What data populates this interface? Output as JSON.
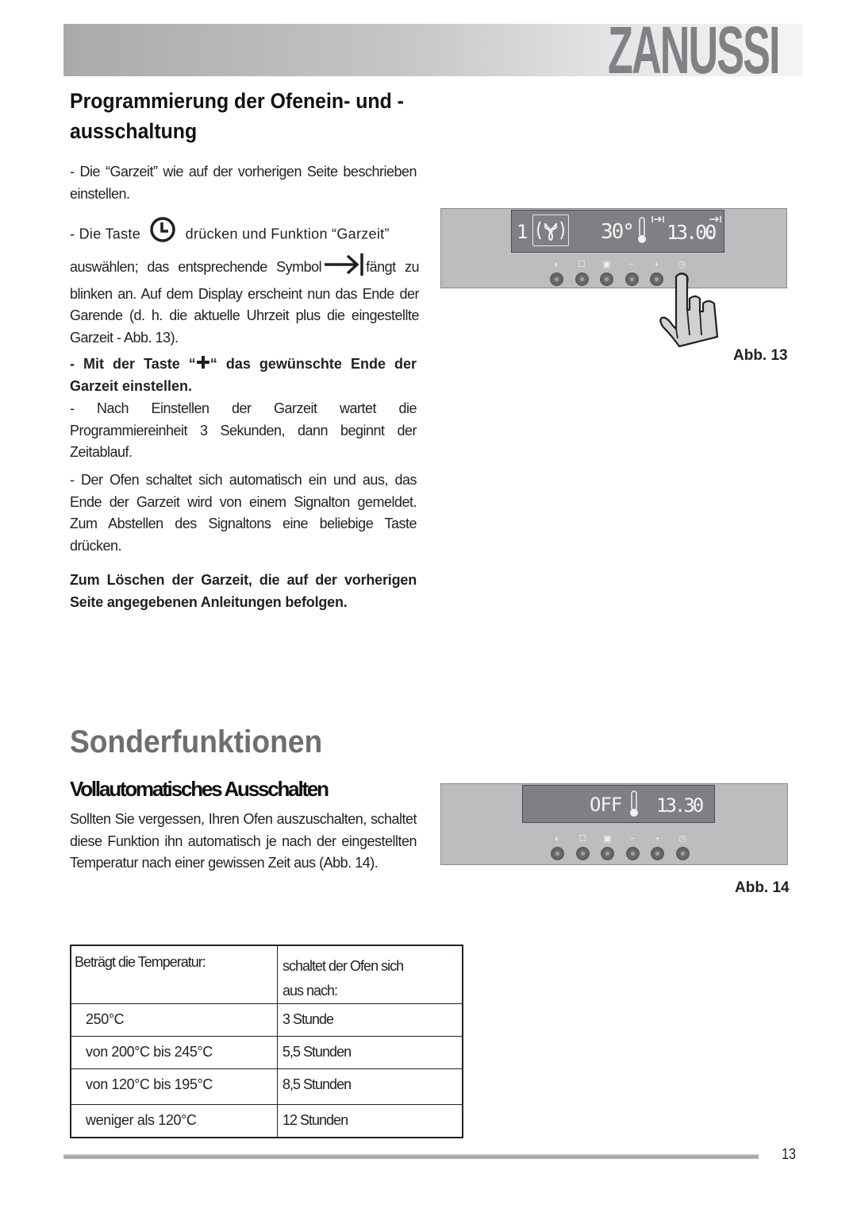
{
  "header": {
    "brand": "ZANUSSI"
  },
  "section1": {
    "title": "Programmierung der Ofenein- und - ausschaltung",
    "p1": "- Die “Garzeit” wie auf der vorherigen Seite beschrieben einstellen.",
    "p2_a": "- Die Taste",
    "p2_icon": "clock-icon",
    "p2_b": "drücken und Funktion “Garzeit”",
    "p2_c": "auswählen; das entsprechende Symbol",
    "p2_symbol": "arrow-to-bar-icon",
    "p2_d": "fängt zu blinken an. Auf dem Display erscheint nun das Ende der Garende (d. h. die aktuelle Uhrzeit plus die eingestellte Garzeit - Abb. 13).",
    "p3_a": "- Mit der Taste “",
    "p3_icon": "plus-icon",
    "p3_b": "“ das gewünschte Ende der Garzeit einstellen.",
    "p4": "- Nach Einstellen der Garzeit wartet die Programmiereinheit 3 Sekunden, dann beginnt der Zeitablauf.",
    "p5": "- Der Ofen schaltet sich automatisch ein und aus, das Ende der Garzeit wird von einem Signalton gemeldet. Zum Abstellen des Signaltons eine beliebige Taste drücken.",
    "p6": "Zum Löschen der Garzeit, die auf der vorherigen Seite angegebenen Anleitungen befolgen."
  },
  "figure13": {
    "caption": "Abb. 13",
    "display": {
      "level": "1",
      "function_icon": "fan-icon",
      "temperature": "30°",
      "thermometer_icon": "thermometer-icon",
      "start_icon": "bar-arrow-bar-icon",
      "end_icon": "arrow-to-bar-icon",
      "time": "13.00",
      "indicator": "▸"
    },
    "buttons": [
      {
        "symbol": "◐",
        "name": "on-off"
      },
      {
        "symbol": "☐",
        "name": "function"
      },
      {
        "symbol": "▣",
        "name": "temperature"
      },
      {
        "symbol": "−",
        "name": "minus"
      },
      {
        "symbol": "+",
        "name": "plus"
      },
      {
        "symbol": "◷",
        "name": "clock"
      }
    ],
    "pressed_button": "clock"
  },
  "section2": {
    "title": "Sonderfunktionen",
    "subtitle": "Vollautomatisches Ausschalten",
    "p1": "Sollten Sie vergessen, Ihren Ofen auszuschalten, schaltet diese Funktion ihn automatisch je nach der eingestellten Temperatur nach einer gewissen Zeit aus (Abb. 14)."
  },
  "figure14": {
    "caption": "Abb. 14",
    "display": {
      "status": "OFF",
      "thermometer_icon": "thermometer-icon",
      "time": "13.30"
    },
    "buttons": [
      {
        "symbol": "◐",
        "name": "on-off"
      },
      {
        "symbol": "☐",
        "name": "function"
      },
      {
        "symbol": "▣",
        "name": "temperature"
      },
      {
        "symbol": "−",
        "name": "minus"
      },
      {
        "symbol": "+",
        "name": "plus"
      },
      {
        "symbol": "◷",
        "name": "clock"
      }
    ]
  },
  "table": {
    "headers": [
      "Beträgt die Temperatur:",
      "schaltet der Ofen sich aus nach:"
    ],
    "rows": [
      [
        "250°C",
        "3 Stunde"
      ],
      [
        "von 200°C bis 245°C",
        "5,5 Stunden"
      ],
      [
        "von 120°C bis 195°C",
        "8,5 Stunden"
      ],
      [
        "weniger als 120°C",
        "12 Stunden"
      ]
    ]
  },
  "footer": {
    "page_number": "13"
  }
}
